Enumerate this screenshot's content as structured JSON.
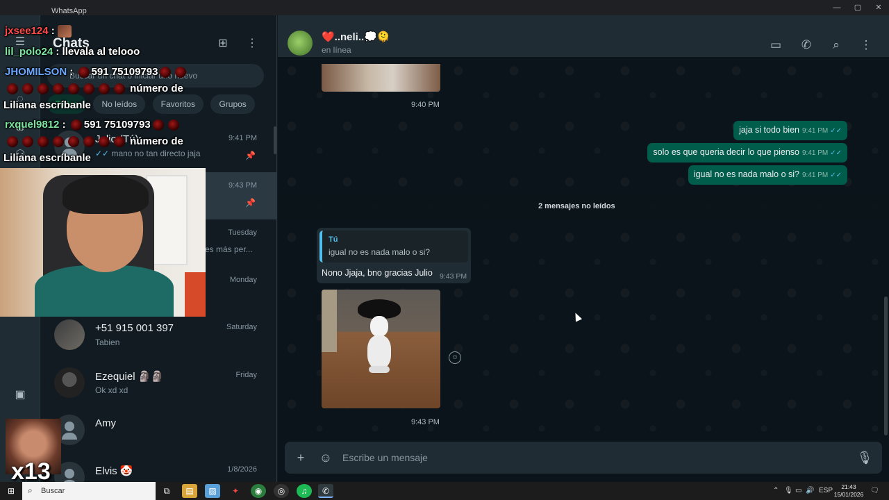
{
  "window": {
    "title": "WhatsApp",
    "minimize": "—",
    "maximize": "▢",
    "close": "✕"
  },
  "rail": {
    "icons": [
      "chats-icon",
      "status-icon",
      "channels-icon",
      "communities-icon",
      "media-icon"
    ]
  },
  "chat_list": {
    "title": "Chats",
    "search_placeholder": "Buscar un chat o iniciar uno nuevo",
    "filters": [
      "Todos",
      "No leídos",
      "Favoritos",
      "Grupos"
    ],
    "chats": [
      {
        "name": "Julio (Tú)",
        "preview": "mano no tan directo jaja",
        "time": "9:41 PM",
        "pinned": true
      },
      {
        "name": "",
        "preview": "",
        "time": "9:43 PM",
        "pinned": true
      },
      {
        "name": "",
        "preview": "es más per...",
        "time": "Tuesday",
        "pinned": false
      },
      {
        "name": "",
        "preview": "",
        "time": "Monday",
        "pinned": false
      },
      {
        "name": "+51 915 001 397",
        "preview": "Tabien",
        "time": "Saturday",
        "pinned": false
      },
      {
        "name": "Ezequiel 🗿🗿",
        "preview": "Ok xd xd",
        "time": "Friday",
        "pinned": false
      },
      {
        "name": "Amy",
        "preview": "",
        "time": "",
        "pinned": false
      },
      {
        "name": "Elvis 🤡",
        "preview": "",
        "time": "1/8/2026",
        "pinned": false
      }
    ]
  },
  "conversation": {
    "contact_name": "❤️..neli..💭🫠",
    "status": "en línea",
    "first_image_time": "9:40 PM",
    "outgoing": [
      {
        "text": "jaja si todo bien",
        "time": "9:41 PM",
        "ticks": "✓✓"
      },
      {
        "text": "solo es que queria decir lo que pienso",
        "time": "9:41 PM",
        "ticks": "✓✓"
      },
      {
        "text": "igual no es nada malo o si?",
        "time": "9:41 PM",
        "ticks": "✓✓"
      }
    ],
    "unread_label": "2 mensajes no leídos",
    "incoming": {
      "quote_author": "Tú",
      "quote_text": "igual no es nada malo o si?",
      "text": "Nono Jjaja, bno gracias Julio",
      "time": "9:43 PM"
    },
    "image_time": "9:43 PM",
    "composer_placeholder": "Escribe un mensaje"
  },
  "stream_chat": [
    {
      "user": "jxsee124",
      "sep": ":",
      "msg": ""
    },
    {
      "user": "lil_polo24",
      "sep": ":",
      "msg": "llevala al telooo"
    },
    {
      "user": "JHOMILSON",
      "sep": ":",
      "msg": "591 75109793"
    },
    {
      "user": "",
      "sep": "",
      "msg": "número de"
    },
    {
      "user": "",
      "sep": "",
      "msg": "Liliana escríbanle"
    },
    {
      "user": "rxquel9812",
      "sep": ":",
      "msg": "591 75109793"
    },
    {
      "user": "",
      "sep": "",
      "msg": "número de"
    },
    {
      "user": "",
      "sep": "",
      "msg": "Liliana escríbanle"
    }
  ],
  "meme_multiplier": "x13",
  "taskbar": {
    "search_label": "Buscar",
    "lang": "ESP",
    "time": "21:43",
    "date": "15/01/2026"
  }
}
